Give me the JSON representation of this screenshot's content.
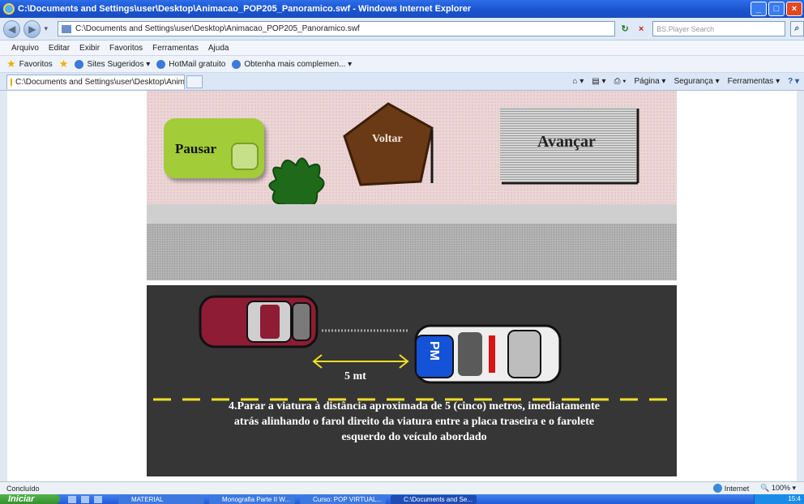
{
  "window": {
    "title": "C:\\Documents and Settings\\user\\Desktop\\Animacao_POP205_Panoramico.swf - Windows Internet Explorer",
    "controls": [
      "_",
      "□",
      "×"
    ]
  },
  "addressbar": {
    "back_icon": "back-arrow-icon",
    "forward_icon": "forward-arrow-icon",
    "url": "C:\\Documents and Settings\\user\\Desktop\\Animacao_POP205_Panoramico.swf",
    "refresh_symbol": "↻",
    "stop_symbol": "×",
    "search_placeholder": "BS.Player Search",
    "search_icon_symbol": "⌕"
  },
  "menu": [
    "Arquivo",
    "Editar",
    "Exibir",
    "Favoritos",
    "Ferramentas",
    "Ajuda"
  ],
  "favorites_bar": {
    "favorites_label": "Favoritos",
    "items": [
      "Sites Sugeridos ▾",
      "HotMail gratuito",
      "Obtenha mais complemen... ▾"
    ]
  },
  "tab": {
    "title": "C:\\Documents and Settings\\user\\Desktop\\Animacao_..."
  },
  "command_bar": [
    "Página ▾",
    "Segurança ▾",
    "Ferramentas ▾"
  ],
  "flash": {
    "pause_button": "Pausar",
    "back_button": "Voltar",
    "next_button": "Avançar",
    "distance_label": "5 mt",
    "police_label": "PM",
    "instruction_lines": [
      "4.Parar a viatura à distância aproximada de 5 (cinco) metros, imediatamente",
      "atrás  alinhando o farol direito da viatura entre a placa traseira e o farolete",
      "esquerdo do veículo abordado"
    ],
    "colors": {
      "pause_green": "#a2cc38",
      "voltar_brown": "#6a3a16",
      "road": "#363636",
      "lane_yellow": "#f1de28",
      "car_maroon": "#8e1c34",
      "police_blue": "#1452d8"
    }
  },
  "statusbar": {
    "status": "Concluído",
    "zone": "Internet",
    "zoom": "100%"
  },
  "taskbar": {
    "start": "Iniciar",
    "buttons": [
      "MATERIAL",
      "Monografia Parte II W...",
      "Curso: POP VIRTUAL...",
      "C:\\Documents and Se..."
    ],
    "clock": "15:4"
  }
}
